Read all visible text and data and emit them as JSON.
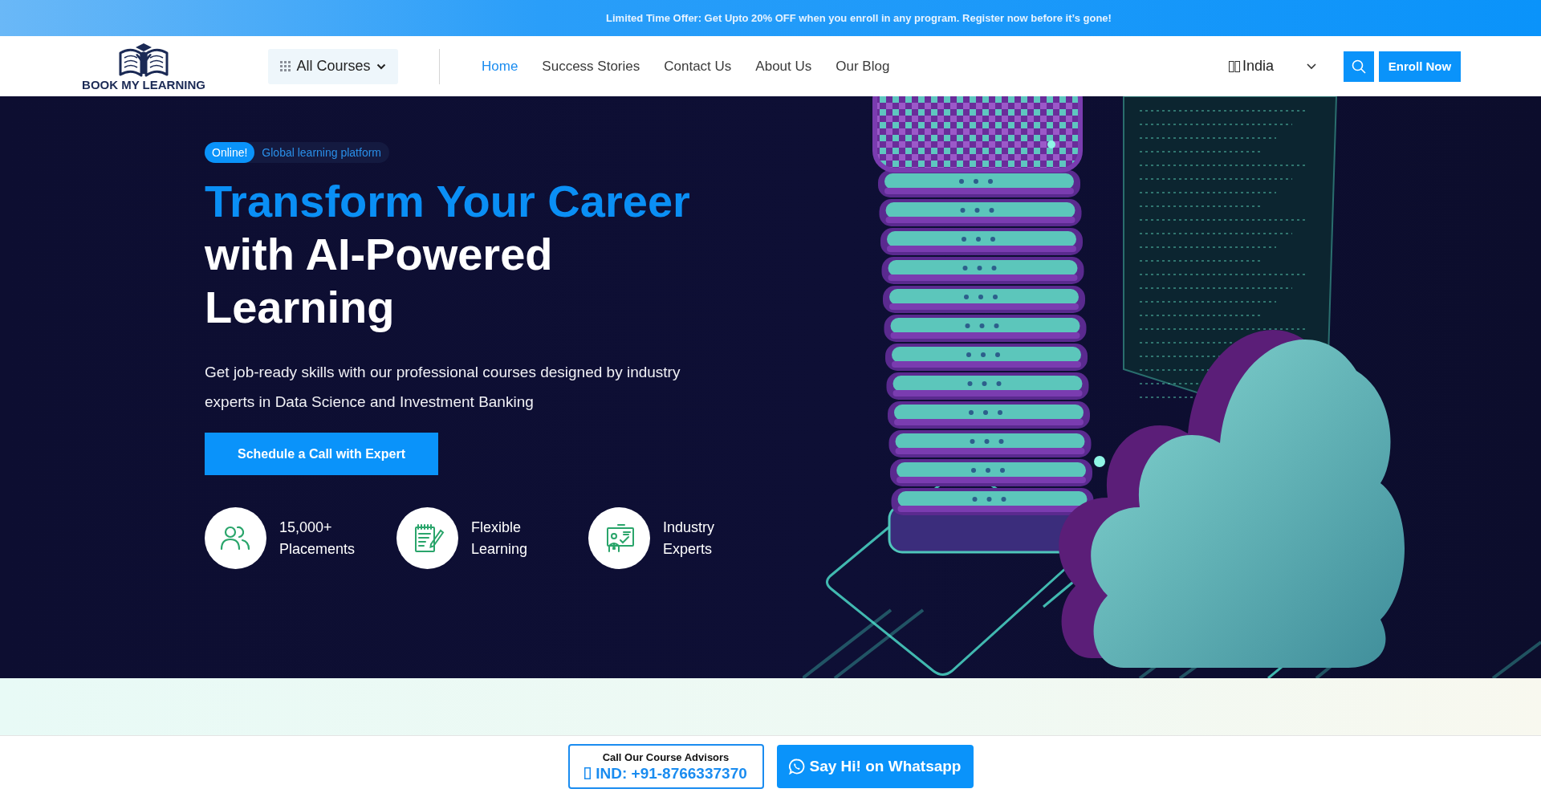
{
  "promo_bar": {
    "text": "Limited Time Offer: Get Upto 20% OFF when you enroll in any program. Register now before it’s gone!"
  },
  "header": {
    "logo_text": "BOOK MY LEARNING",
    "courses_button": "All Courses",
    "nav": [
      {
        "label": "Home",
        "selected": true
      },
      {
        "label": "Success Stories",
        "selected": false
      },
      {
        "label": "Contact Us",
        "selected": false
      },
      {
        "label": "About Us",
        "selected": false
      },
      {
        "label": "Our Blog",
        "selected": false
      }
    ],
    "region": "India",
    "enroll_button": "Enroll Now"
  },
  "hero": {
    "badge": "Online!",
    "tagline": "Global learning platform",
    "title_accent": "Transform Your Career",
    "title": "with AI-Powered Learning",
    "description": "Get job-ready skills with our professional courses designed by industry experts in Data Science and Investment Banking",
    "cta_button": "Schedule a Call with Expert",
    "features": [
      {
        "kind": "people",
        "label": "15,000+ Placements"
      },
      {
        "kind": "notepad",
        "label": "Flexible Learning"
      },
      {
        "kind": "presentation",
        "label": "Industry Experts"
      }
    ]
  },
  "contact_bar": {
    "heading": "Call Our Course Advisors",
    "phone": "IND: +91-8766337370",
    "whatsapp_button": "Say Hi! on Whatsapp"
  }
}
